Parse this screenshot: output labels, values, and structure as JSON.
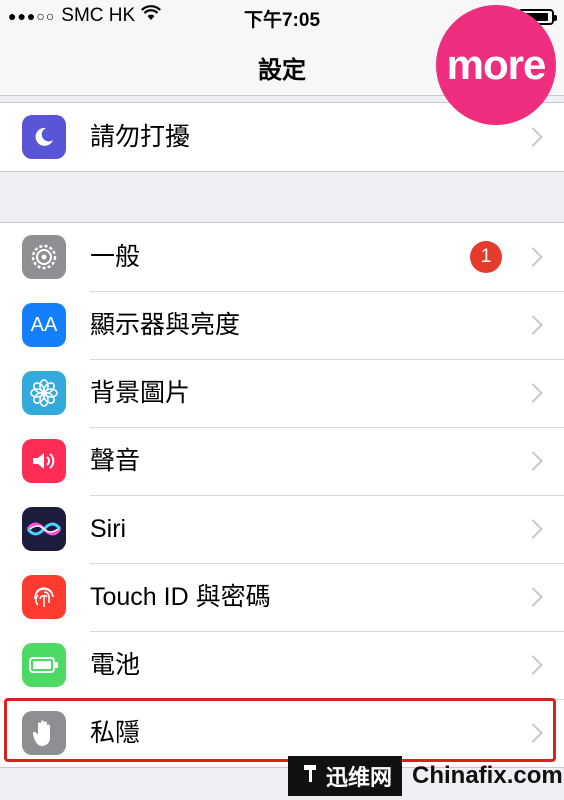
{
  "status_bar": {
    "carrier": "SMC HK",
    "signal_dots": "●●●○○",
    "time": "下午7:05"
  },
  "navbar": {
    "title": "設定"
  },
  "logo": {
    "text": "more"
  },
  "groups": [
    {
      "items": [
        {
          "label": "請勿打擾",
          "icon": "moon-icon",
          "color": "#5856d6"
        }
      ]
    },
    {
      "items": [
        {
          "label": "一般",
          "icon": "gear-icon",
          "color": "#8e8e93",
          "badge": "1"
        },
        {
          "label": "顯示器與亮度",
          "icon": "text-size-icon",
          "color": "#147efb",
          "icon_text": "AA"
        },
        {
          "label": "背景圖片",
          "icon": "flower-icon",
          "color": "#34aadc"
        },
        {
          "label": "聲音",
          "icon": "speaker-icon",
          "color": "#ff2d55"
        },
        {
          "label": "Siri",
          "icon": "siri-icon",
          "color": "#1c1c3c"
        },
        {
          "label": "Touch ID 與密碼",
          "icon": "fingerprint-icon",
          "color": "#ff3b30"
        },
        {
          "label": "電池",
          "icon": "battery-icon",
          "color": "#4cd964"
        },
        {
          "label": "私隱",
          "icon": "hand-icon",
          "color": "#8e8e93"
        }
      ]
    }
  ],
  "watermark": {
    "left_text": "迅维网",
    "right_text": "Chinafix.com"
  },
  "colors": {
    "badge": "#e53b2c",
    "highlight": "#d7231e",
    "logo": "#ee2d7f"
  }
}
